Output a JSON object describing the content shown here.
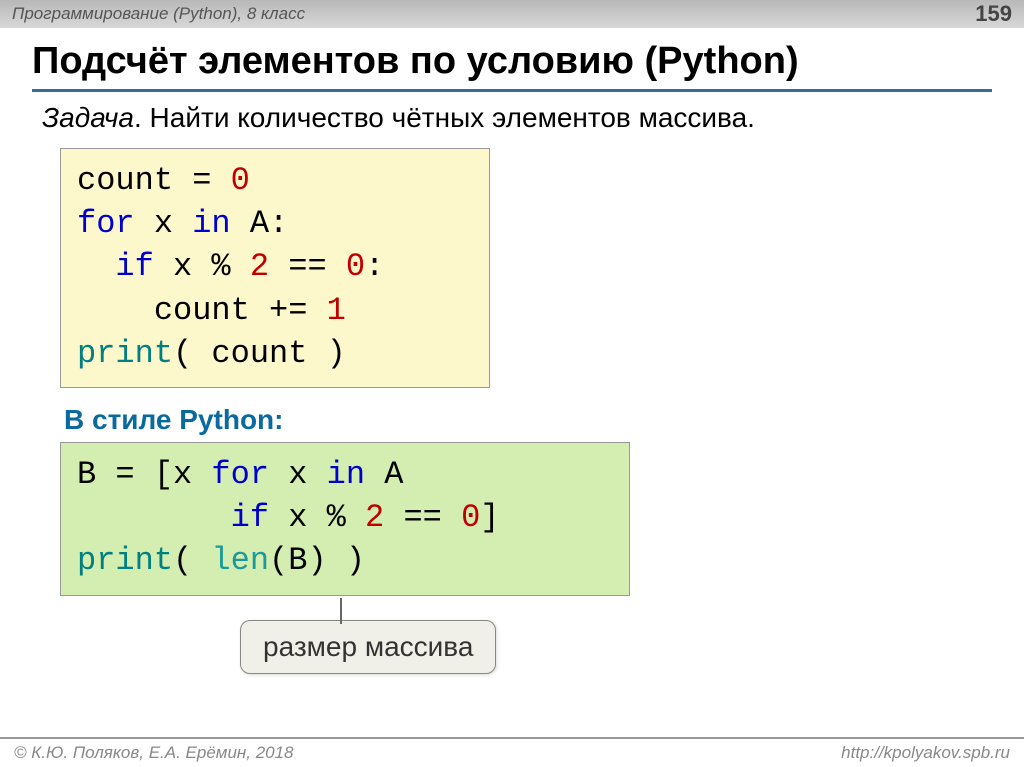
{
  "header": {
    "breadcrumb": "Программирование (Python), 8 класс",
    "page_number": "159"
  },
  "title": "Подсчёт элементов по условию (Python)",
  "task": {
    "label": "Задача",
    "text": ". Найти количество чётных элементов массива."
  },
  "code1": {
    "l1a": "count = ",
    "l1b": "0",
    "l2a": "for",
    "l2b": " x ",
    "l2c": "in",
    "l2d": " A:",
    "l3a": "  ",
    "l3b": "if",
    "l3c": " x % ",
    "l3d": "2",
    "l3e": " == ",
    "l3f": "0",
    "l3g": ":",
    "l4a": "    count += ",
    "l4b": "1",
    "l5a": "print",
    "l5b": "( count )"
  },
  "subhead": "В стиле Python:",
  "code2": {
    "l1a": "B = [x ",
    "l1b": "for",
    "l1c": " x ",
    "l1d": "in",
    "l1e": " A",
    "l2a": "        ",
    "l2b": "if",
    "l2c": " x % ",
    "l2d": "2",
    "l2e": " == ",
    "l2f": "0",
    "l2g": "]",
    "l3a": "print",
    "l3b": "( ",
    "l3c": "len",
    "l3d": "(B) )"
  },
  "callout": "размер массива",
  "footer": {
    "left": "© К.Ю. Поляков, Е.А. Ерёмин, 2018",
    "right": "http://kpolyakov.spb.ru"
  }
}
